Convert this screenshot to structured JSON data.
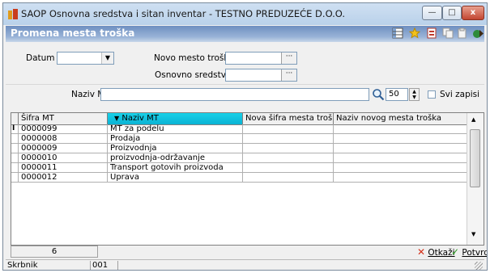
{
  "window": {
    "title": "SAOP Osnovna sredstva i sitan inventar - TESTNO PREDUZEĆE D.O.O.",
    "minimize_glyph": "—",
    "maximize_glyph": "□",
    "close_glyph": "x"
  },
  "header": {
    "title": "Promena mesta troška",
    "toolbar_icons": [
      "grid-icon",
      "star-icon",
      "document-icon",
      "copy-icon",
      "paste-icon",
      "exit-icon"
    ]
  },
  "filters": {
    "datum_label": "Datum",
    "datum_value": "",
    "novo_mesto_label": "Novo mesto troška",
    "novo_mesto_value": "",
    "osnovno_label": "Osnovno sredstvo",
    "osnovno_value": "",
    "dots": "···"
  },
  "search": {
    "label": "Naziv MT",
    "value": "",
    "count": "50",
    "svi_label": "Svi zapisi",
    "svi_checked": false
  },
  "table": {
    "columns": [
      "Šifra MT",
      "Naziv MT",
      "Nova šifra mesta troška",
      "Naziv novog mesta troška"
    ],
    "sorted_column": 1,
    "sort_arrow": "▼",
    "current_row_marker": "I",
    "rows": [
      [
        "0000099",
        "MT za podelu",
        "",
        ""
      ],
      [
        "0000008",
        "Prodaja",
        "",
        ""
      ],
      [
        "0000009",
        "Proizvodnja",
        "",
        ""
      ],
      [
        "0000010",
        "proizvodnja-održavanje",
        "",
        ""
      ],
      [
        "0000011",
        "Transport gotovih proizvoda",
        "",
        ""
      ],
      [
        "0000012",
        "Uprava",
        "",
        ""
      ]
    ]
  },
  "footer": {
    "record_count": "6",
    "cancel_label": "Otkaži",
    "confirm_label": "Potvrdi",
    "cancel_color": "#d4311a",
    "confirm_color": "#2a9a1f"
  },
  "statusbar": {
    "user_label": "Skrbnik",
    "user_value": "001"
  }
}
